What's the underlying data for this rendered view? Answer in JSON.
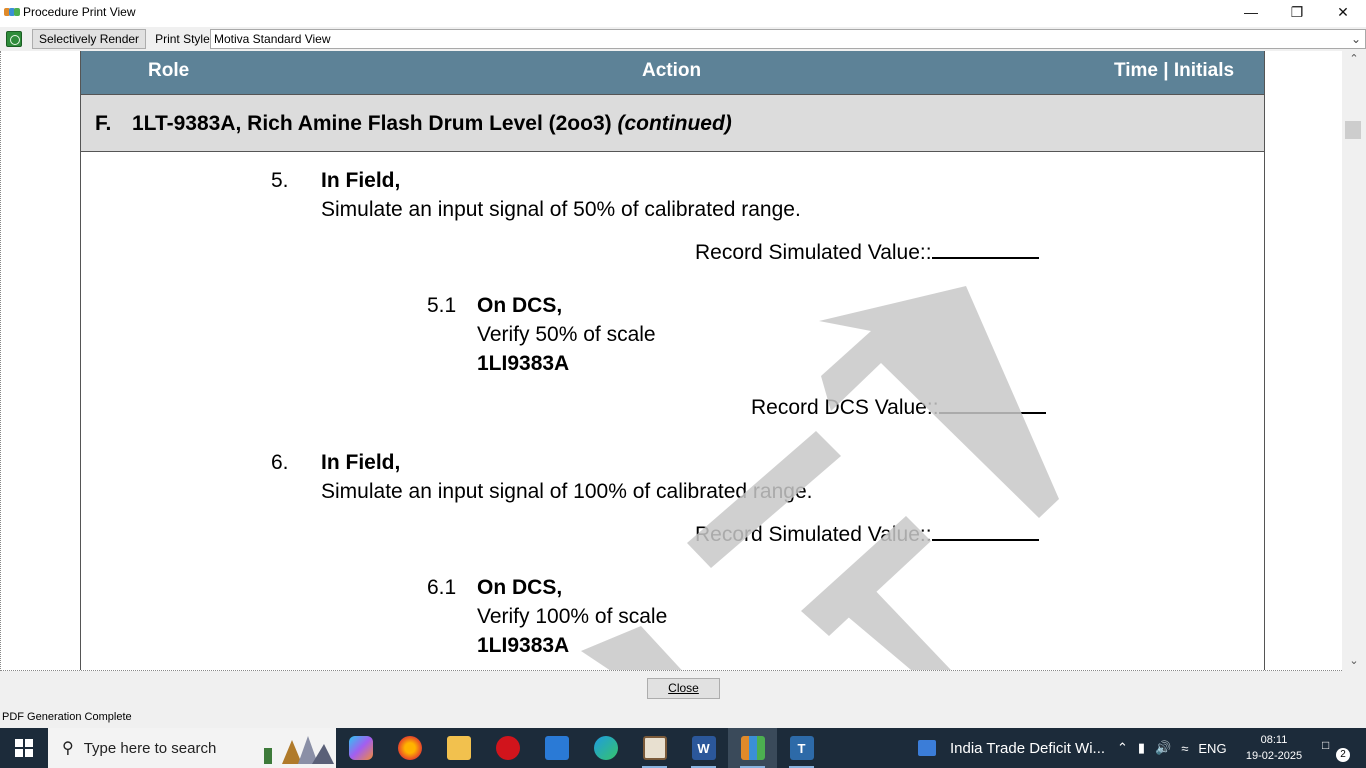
{
  "window": {
    "title": "Procedure Print View",
    "minimize": "—",
    "restore": "❐",
    "close": "✕"
  },
  "toolbar": {
    "render_button": "Selectively Render",
    "print_style_label": "Print Style:",
    "print_style_value": "Motiva Standard View"
  },
  "document": {
    "header": {
      "role": "Role",
      "action": "Action",
      "time_initials": "Time | Initials"
    },
    "section": {
      "letter": "F.",
      "title": "1LT-9383A, Rich Amine Flash Drum Level (2oo3) ",
      "continued": "(continued)"
    },
    "steps": [
      {
        "number": "5.",
        "location": "In Field,",
        "instruction": "Simulate an input signal of 50% of calibrated range.",
        "record_label": "Record Simulated Value::",
        "substep": {
          "number": "5.1",
          "location": "On DCS,",
          "instruction": "Verify 50% of scale",
          "tag": "1LI9383A",
          "record_label": "Record DCS Value::"
        }
      },
      {
        "number": "6.",
        "location": "In Field,",
        "instruction": "Simulate an input signal of 100% of calibrated range.",
        "record_label": "Record Simulated Value::",
        "substep": {
          "number": "6.1",
          "location": "On DCS,",
          "instruction": "Verify 100% of scale",
          "tag": "1LI9383A"
        }
      }
    ],
    "watermark": "DRAFT"
  },
  "footer": {
    "close_button": "Close",
    "status": "PDF Generation Complete"
  },
  "taskbar": {
    "search_placeholder": "Type here to search",
    "news_text": "India Trade Deficit Wi...",
    "language": "ENG",
    "time": "08:11",
    "date": "19-02-2025",
    "notification_count": "2"
  },
  "colors": {
    "header_bg": "#5d8297",
    "section_bg": "#dcdcdc",
    "watermark": "#c8c8c8",
    "taskbar_bg": "#1c2b3a"
  }
}
